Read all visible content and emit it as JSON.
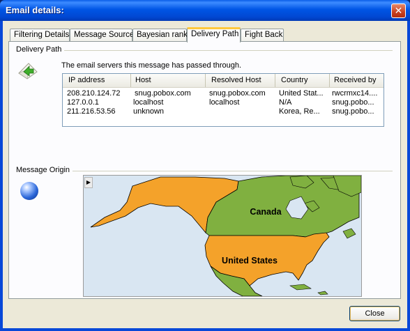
{
  "window": {
    "title": "Email details:"
  },
  "tabs": [
    {
      "label": "Filtering Details"
    },
    {
      "label": "Message Source"
    },
    {
      "label": "Bayesian rank"
    },
    {
      "label": "Delivery Path"
    },
    {
      "label": "Fight Back"
    }
  ],
  "active_tab": "Delivery Path",
  "delivery_path": {
    "group_label": "Delivery Path",
    "description": "The email servers this message has passed through.",
    "columns": [
      "IP address",
      "Host",
      "Resolved Host",
      "Country",
      "Received by"
    ],
    "rows": [
      [
        "208.210.124.72",
        "snug.pobox.com",
        "snug.pobox.com",
        "United Stat...",
        "rwcrmxc14...."
      ],
      [
        "127.0.0.1",
        "localhost",
        "localhost",
        "N/A",
        "snug.pobo..."
      ],
      [
        "211.216.53.56",
        "unknown",
        "",
        "Korea, Re...",
        "snug.pobo..."
      ]
    ]
  },
  "message_origin": {
    "group_label": "Message Origin",
    "map_labels": {
      "canada": "Canada",
      "usa": "United States"
    },
    "colors": {
      "ocean": "#d9e6f2",
      "canada": "#80b040",
      "usa": "#f4a22a",
      "alaska": "#f4a22a",
      "other_land": "#80b040",
      "border": "#000000"
    }
  },
  "buttons": {
    "close": "Close"
  },
  "icons": {
    "title_close": "close-icon",
    "envelope": "envelope-arrow-icon",
    "globe": "globe-icon",
    "map_toggle": "chevron-right-icon"
  }
}
